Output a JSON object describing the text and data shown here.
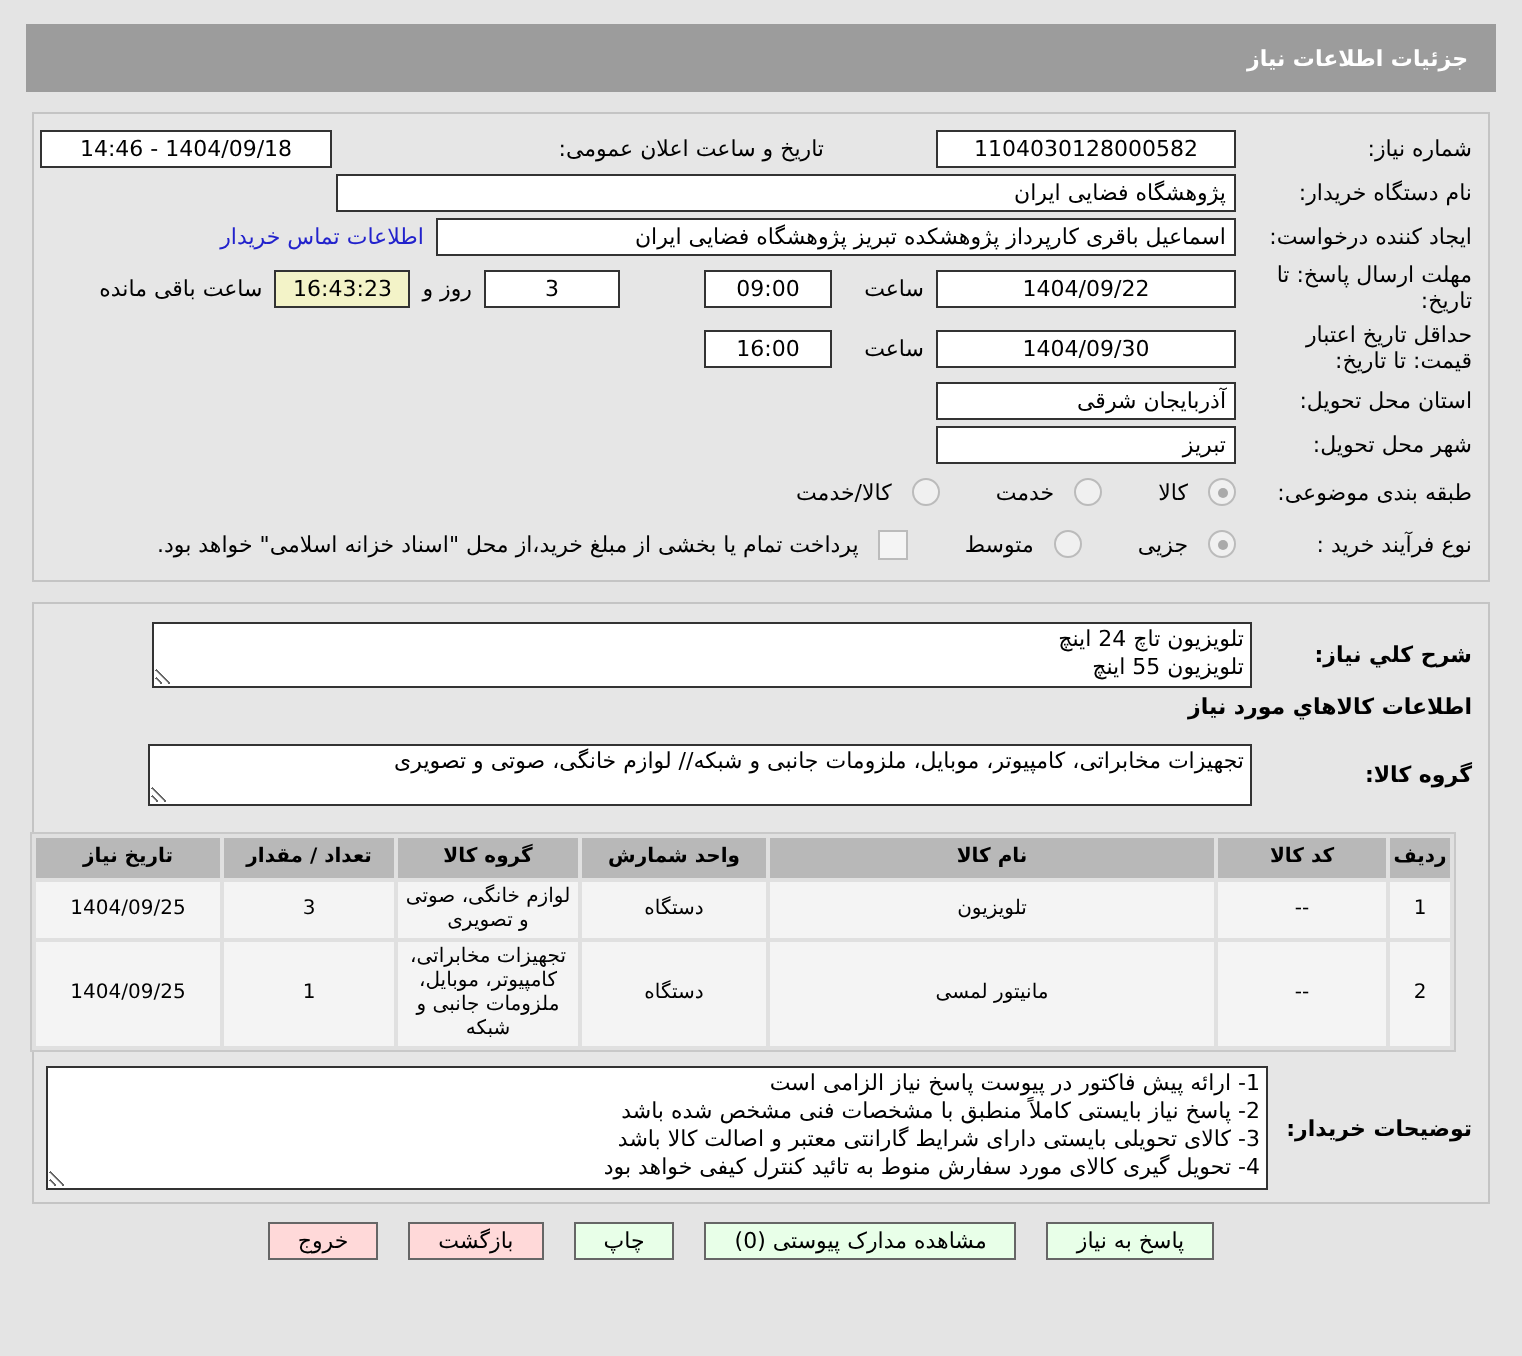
{
  "header": {
    "title": "جزئیات اطلاعات نیاز"
  },
  "info": {
    "need_number": {
      "label": "شماره نیاز:",
      "value": "1104030128000582"
    },
    "announce": {
      "label": "تاریخ و ساعت اعلان عمومی:",
      "value": "1404/09/18 - 14:46"
    },
    "buyer": {
      "label": "نام دستگاه خریدار:",
      "value": "پژوهشگاه فضایی ایران"
    },
    "creator": {
      "label": "ایجاد کننده درخواست:",
      "value": "اسماعیل باقری کارپرداز پژوهشکده تبریز پژوهشگاه فضایی ایران",
      "link": "اطلاعات تماس خریدار"
    },
    "deadline": {
      "label": "مهلت ارسال پاسخ: تا تاریخ:",
      "date": "1404/09/22",
      "time_label": "ساعت",
      "time": "09:00",
      "days": "3",
      "days_label": "روز و",
      "remaining": "16:43:23",
      "remaining_label": "ساعت باقی مانده"
    },
    "validity": {
      "label": "حداقل تاریخ اعتبار قیمت: تا تاریخ:",
      "date": "1404/09/30",
      "time_label": "ساعت",
      "time": "16:00"
    },
    "province": {
      "label": "استان محل تحویل:",
      "value": "آذربایجان شرقی"
    },
    "city": {
      "label": "شهر محل تحویل:",
      "value": "تبریز"
    },
    "category": {
      "label": "طبقه بندی موضوعی:",
      "options": [
        {
          "label": "کالا",
          "selected": true
        },
        {
          "label": "خدمت",
          "selected": false
        },
        {
          "label": "کالا/خدمت",
          "selected": false
        }
      ]
    },
    "process": {
      "label": "نوع فرآیند خرید :",
      "options": [
        {
          "label": "جزیی",
          "selected": true
        },
        {
          "label": "متوسط",
          "selected": false
        }
      ],
      "treasury": {
        "label": "پرداخت تمام یا بخشی از مبلغ خرید،از محل \"اسناد خزانه اسلامی\" خواهد بود.",
        "checked": false
      }
    }
  },
  "details": {
    "summary_label": "شرح کلي نياز:",
    "summary_lines": [
      "تلويزيون تاچ 24 اينچ",
      "تلويزيون 55 اينچ"
    ],
    "goods_heading": "اطلاعات کالاهاي مورد نياز",
    "group_label": "گروه کالا:",
    "group_value": "تجهیزات مخابراتی، کامپیوتر، موبایل، ملزومات جانبی و شبکه// لوازم خانگی، صوتی و تصویری",
    "table": {
      "columns": [
        "ردیف",
        "کد کالا",
        "نام کالا",
        "واحد شمارش",
        "گروه کالا",
        "تعداد / مقدار",
        "تاریخ نیاز"
      ],
      "rows": [
        [
          "1",
          "--",
          "تلویزیون",
          "دستگاه",
          "لوازم خانگی، صوتی و تصویری",
          "3",
          "1404/09/25"
        ],
        [
          "2",
          "--",
          "مانیتور لمسی",
          "دستگاه",
          "تجهیزات مخابراتی، کامپیوتر، موبایل، ملزومات جانبی و شبکه",
          "1",
          "1404/09/25"
        ]
      ]
    },
    "notes_label": "توضیحات خریدار:",
    "notes_lines": [
      "1- ارائه پیش فاکتور در پیوست پاسخ نیاز الزامی است",
      "2- پاسخ نیاز بایستی کاملاً منطبق با مشخصات فنی مشخص شده باشد",
      "3- کالای تحویلی بایستی دارای شرایط گارانتی معتبر و اصالت کالا باشد",
      "4- تحویل گیری کالای مورد سفارش منوط به تائید کنترل کیفی خواهد بود"
    ]
  },
  "buttons": [
    {
      "label": "پاسخ به نیاز",
      "kind": "primary"
    },
    {
      "label": "مشاهده مدارک پیوستی (0)",
      "kind": "primary"
    },
    {
      "label": "چاپ",
      "kind": "primary"
    },
    {
      "label": "بازگشت",
      "kind": "danger"
    },
    {
      "label": "خروج",
      "kind": "danger"
    }
  ]
}
